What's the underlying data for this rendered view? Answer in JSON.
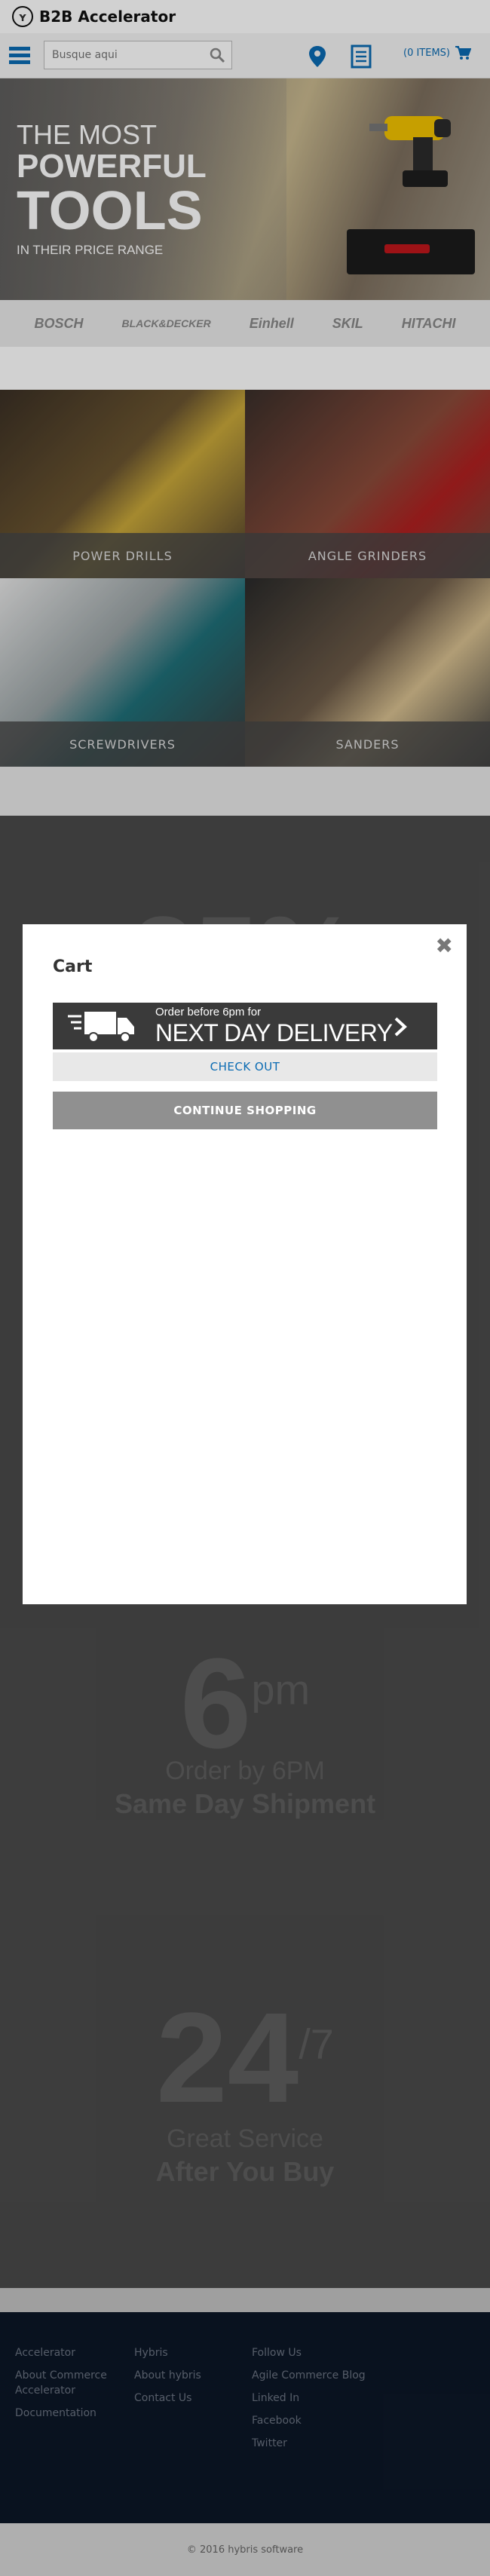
{
  "header": {
    "logo_mark": "ʏ",
    "logo_text": "B2B Accelerator",
    "search_placeholder": "Busque aqui",
    "cart_label": "(0 ITEMS)"
  },
  "hero": {
    "line1": "THE MOST",
    "line2": "POWERFUL",
    "line3": "TOOLS",
    "line4": "IN THEIR PRICE RANGE"
  },
  "brands": [
    "BOSCH",
    "BLACK&DECKER",
    "Einhell",
    "SKIL",
    "HITACHI"
  ],
  "categories": [
    {
      "label": "POWER DRILLS",
      "color": "#6b5530"
    },
    {
      "label": "ANGLE GRINDERS",
      "color": "#8a4b3a"
    },
    {
      "label": "SCREWDRIVERS",
      "color": "#5a6064"
    },
    {
      "label": "SANDERS",
      "color": "#6d5b48"
    }
  ],
  "promo": {
    "big1": "25%",
    "big2": "6",
    "big2_sup": "pm",
    "sub2a": "Order by 6PM",
    "sub2b": "Same Day Shipment",
    "big3": "24",
    "big3_sup": "/7",
    "sub3a": "Great Service",
    "sub3b": "After You Buy"
  },
  "modal": {
    "title": "Cart",
    "close": "✖",
    "delivery_small": "Order before 6pm for",
    "delivery_big": "NEXT DAY DELIVERY",
    "checkout": "CHECK OUT",
    "continue": "CONTINUE SHOPPING"
  },
  "footer": {
    "col1": [
      "Accelerator",
      "About Commerce Accelerator",
      "Documentation"
    ],
    "col2": [
      "Hybris",
      "About hybris",
      "Contact Us"
    ],
    "col3": [
      "Follow Us",
      "Agile Commerce Blog",
      "Linked In",
      "Facebook",
      "Twitter"
    ],
    "copyright": "© 2016 hybris software"
  }
}
